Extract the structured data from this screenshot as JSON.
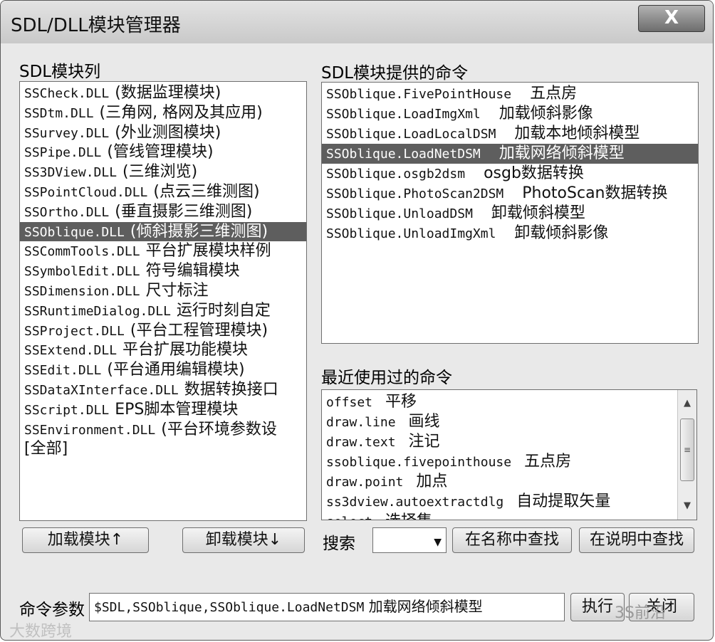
{
  "window": {
    "title": "SDL/DLL模块管理器",
    "close_label": "X"
  },
  "modules": {
    "label": "SDL模块列",
    "items": [
      {
        "name": "SSCheck.DLL",
        "desc": "(数据监理模块)"
      },
      {
        "name": "SSDtm.DLL",
        "desc": "(三角网, 格网及其应用)"
      },
      {
        "name": "SSurvey.DLL",
        "desc": "(外业测图模块)"
      },
      {
        "name": "SSPipe.DLL",
        "desc": "(管线管理模块)"
      },
      {
        "name": "SS3DView.DLL",
        "desc": "(三维浏览)"
      },
      {
        "name": "SSPointCloud.DLL",
        "desc": "(点云三维测图)"
      },
      {
        "name": "SSOrtho.DLL",
        "desc": "(垂直摄影三维测图)"
      },
      {
        "name": "SSOblique.DLL",
        "desc": "(倾斜摄影三维测图)"
      },
      {
        "name": "SSCommTools.DLL",
        "desc": "平台扩展模块样例"
      },
      {
        "name": "SSymbolEdit.DLL",
        "desc": "符号编辑模块"
      },
      {
        "name": "SSDimension.DLL",
        "desc": "尺寸标注"
      },
      {
        "name": "SSRuntimeDialog.DLL",
        "desc": "运行时刻自定"
      },
      {
        "name": "SSProject.DLL",
        "desc": "(平台工程管理模块)"
      },
      {
        "name": "SSExtend.DLL",
        "desc": "平台扩展功能模块"
      },
      {
        "name": "SSEdit.DLL",
        "desc": "(平台通用编辑模块)"
      },
      {
        "name": "SSDataXInterface.DLL",
        "desc": "数据转换接口"
      },
      {
        "name": "SScript.DLL",
        "desc": "EPS脚本管理模块"
      },
      {
        "name": "SSEnvironment.DLL",
        "desc": "(平台环境参数设"
      },
      {
        "name": "",
        "desc": "[全部]"
      }
    ]
  },
  "commands": {
    "label": "SDL模块提供的命令",
    "items": [
      {
        "name": "SSOblique.FivePointHouse",
        "desc": "五点房"
      },
      {
        "name": "SSOblique.LoadImgXml",
        "desc": "加载倾斜影像"
      },
      {
        "name": "SSOblique.LoadLocalDSM",
        "desc": "加载本地倾斜模型"
      },
      {
        "name": "SSOblique.LoadNetDSM",
        "desc": "加载网络倾斜模型"
      },
      {
        "name": "SSOblique.osgb2dsm",
        "desc": "osgb数据转换"
      },
      {
        "name": "SSOblique.PhotoScan2DSM",
        "desc": "PhotoScan数据转换"
      },
      {
        "name": "SSOblique.UnloadDSM",
        "desc": "卸载倾斜模型"
      },
      {
        "name": "SSOblique.UnloadImgXml",
        "desc": "卸载倾斜影像"
      }
    ]
  },
  "recent": {
    "label": "最近使用过的命令",
    "items": [
      {
        "name": "offset",
        "desc": "平移"
      },
      {
        "name": "draw.line",
        "desc": "画线"
      },
      {
        "name": "draw.text",
        "desc": "注记"
      },
      {
        "name": "ssoblique.fivepointhouse",
        "desc": "五点房"
      },
      {
        "name": "draw.point",
        "desc": "加点"
      },
      {
        "name": "ss3dview.autoextractdlg",
        "desc": "自动提取矢量"
      },
      {
        "name": "select",
        "desc": "选择集"
      }
    ]
  },
  "buttons": {
    "load_module": "加载模块↑",
    "unload_module": "卸载模块↓",
    "find_in_name": "在名称中查找",
    "find_in_desc": "在说明中查找",
    "execute": "执行",
    "close": "关闭"
  },
  "search": {
    "label": "搜索",
    "value": ""
  },
  "params": {
    "label": "命令参数",
    "value_name": "$SDL,SSOblique,SSOblique.LoadNetDSM",
    "value_desc": "加载网络倾斜模型"
  },
  "watermarks": {
    "left": "大数跨境",
    "right": "3S前沿"
  }
}
